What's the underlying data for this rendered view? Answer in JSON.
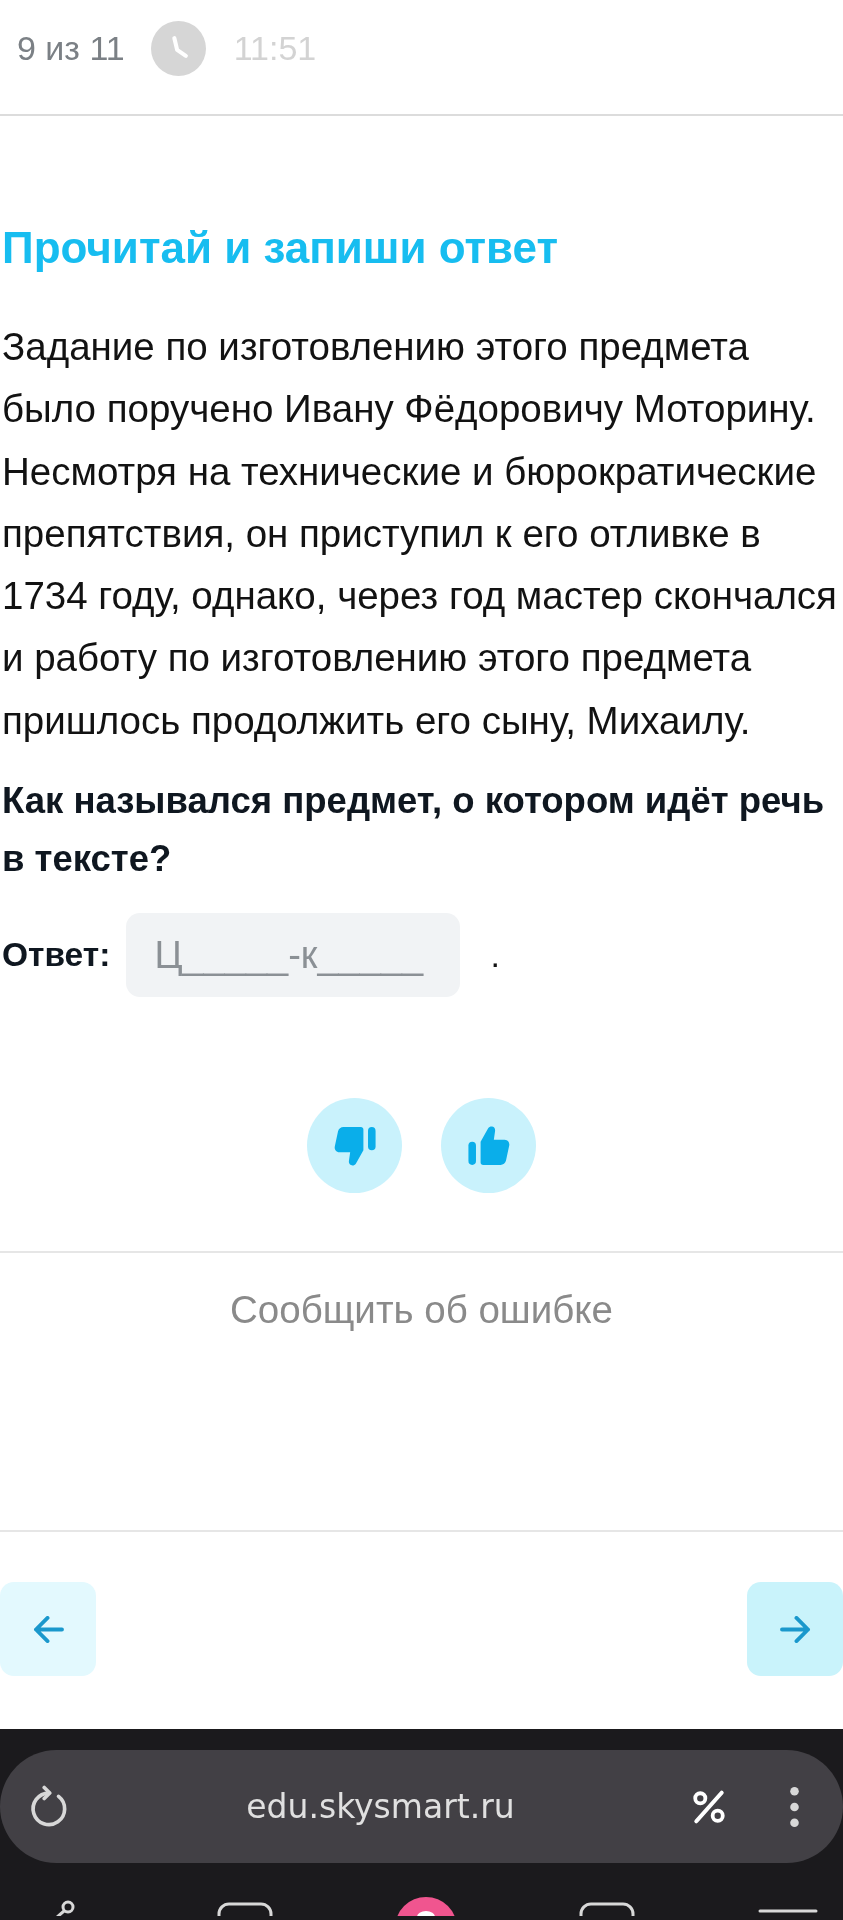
{
  "header": {
    "progress": "9 из 11",
    "timer": "11:51"
  },
  "task": {
    "title": "Прочитай и запиши ответ",
    "text": "Задание по изготовлению этого предмета было поручено Ивану Фёдоровичу Моторину. Несмотря на технические и бюрократические препятствия, он приступил к его отливке в 1734 году, однако, через год мастер скончался и работу по изготовлению этого предмета пришлось продолжить его сыну, Михаилу.",
    "question": "Как назывался предмет, о котором идёт речь в тексте?",
    "answer": {
      "label": "Ответ:",
      "placeholder": "Ц_____-к_____",
      "suffix": "."
    }
  },
  "feedback": [
    {
      "kind": "dislike"
    },
    {
      "kind": "like"
    }
  ],
  "report_link": "Сообщить об ошибке",
  "navigation": [
    {
      "kind": "prev",
      "disabled": true
    },
    {
      "kind": "next",
      "disabled": false
    }
  ],
  "browser": {
    "url": "edu.skysmart.ru"
  }
}
